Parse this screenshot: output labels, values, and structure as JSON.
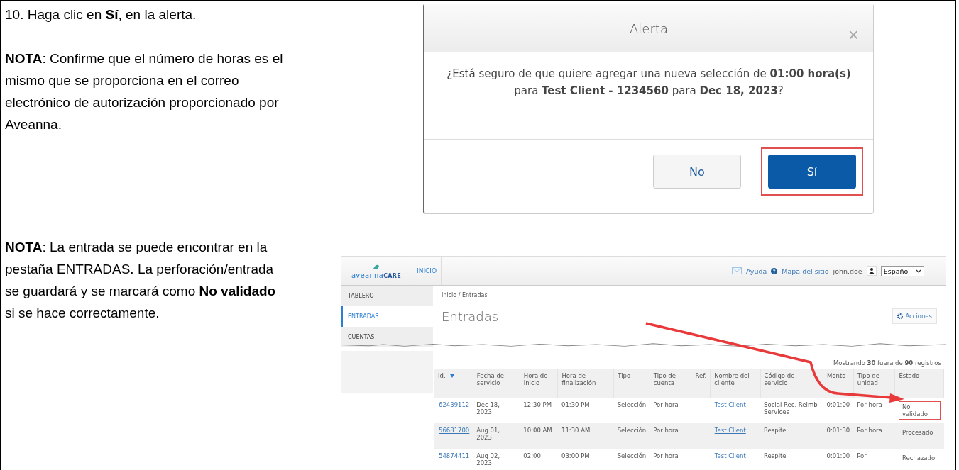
{
  "steps": [
    {
      "texts": [
        "10. Haga clic en **Sí**, en la alerta.",
        "**NOTA**: Confirme que el número de horas es el mismo que se proporciona en el correo electrónico de autorización proporcionado por Aveanna."
      ],
      "kind": "dialog",
      "dialog": {
        "title": "Alerta",
        "close": "×",
        "message": "¿Está seguro de que quiere agregar una nueva selección de **01:00 hora(s)** para **Test Client - 1234560** para **Dec 18, 2023**?",
        "buttons": [
          {
            "label": "No",
            "primary": false,
            "highlighted": false
          },
          {
            "label": "Sí",
            "primary": true,
            "highlighted": true
          }
        ]
      }
    },
    {
      "texts": [
        "**NOTA**: La entrada se puede encontrar en la  pestaña ENTRADAS. La perforación/entrada se guardará y se marcará como **No validado** si se hace correctamente."
      ],
      "kind": "app",
      "app": {
        "logo": {
          "name": "aveanna",
          "suffix": "CARE"
        },
        "nav": "INICIO",
        "header_links": [
          "Ayuda",
          "Mapa del sitio"
        ],
        "user": "john.doe",
        "language": "Español",
        "sidebar": [
          {
            "label": "TABLERO",
            "selected": false
          },
          {
            "label": "ENTRADAS",
            "selected": true
          },
          {
            "label": "CUENTAS",
            "selected": false
          }
        ],
        "breadcrumb": "Inicio / Entradas",
        "title": "Entradas",
        "actions": "Acciones",
        "summary": "Mostrando **30** fuera de **90** registros",
        "columns": [
          {
            "label": "Id.",
            "link": true,
            "sorted": true
          },
          {
            "label": "Fecha de servicio",
            "link": false,
            "sorted": false
          },
          {
            "label": "Hora de inicio",
            "link": false,
            "sorted": false
          },
          {
            "label": "Hora de finalización",
            "link": false,
            "sorted": false
          },
          {
            "label": "Tipo",
            "link": false,
            "sorted": false
          },
          {
            "label": "Tipo de cuenta",
            "link": false,
            "sorted": false
          },
          {
            "label": "Ref.",
            "link": false,
            "sorted": false
          },
          {
            "label": "Nombre del cliente",
            "link": true,
            "sorted": false
          },
          {
            "label": "Código de servicio",
            "link": false,
            "sorted": false
          },
          {
            "label": "Monto",
            "link": false,
            "sorted": false
          },
          {
            "label": "Tipo de unidad",
            "link": false,
            "sorted": false
          },
          {
            "label": "Estado",
            "link": false,
            "sorted": false
          }
        ],
        "rows": [
          {
            "cells": [
              "62439112",
              "Dec 18, 2023",
              "12:30 PM",
              "01:30 PM",
              "Selección",
              "Por hora",
              "",
              "Test Client",
              "Social Rec. Reimb Services",
              "0:01:00",
              "Por hora",
              "No validado"
            ],
            "highlighted": true
          },
          {
            "cells": [
              "56681700",
              "Aug 01, 2023",
              "10:00 AM",
              "11:30 AM",
              "Selección",
              "Por hora",
              "",
              "Test Client",
              "Respite",
              "0:01:30",
              "Por hora",
              "Procesado"
            ],
            "highlighted": false
          },
          {
            "cells": [
              "54874411",
              "Aug 02, 2023",
              "02:00",
              "03:00 PM",
              "Selección",
              "Por hora",
              "",
              "Test Client",
              "Respite",
              "0:01:00",
              "Por",
              "Rechazado"
            ],
            "highlighted": false
          }
        ]
      }
    }
  ]
}
